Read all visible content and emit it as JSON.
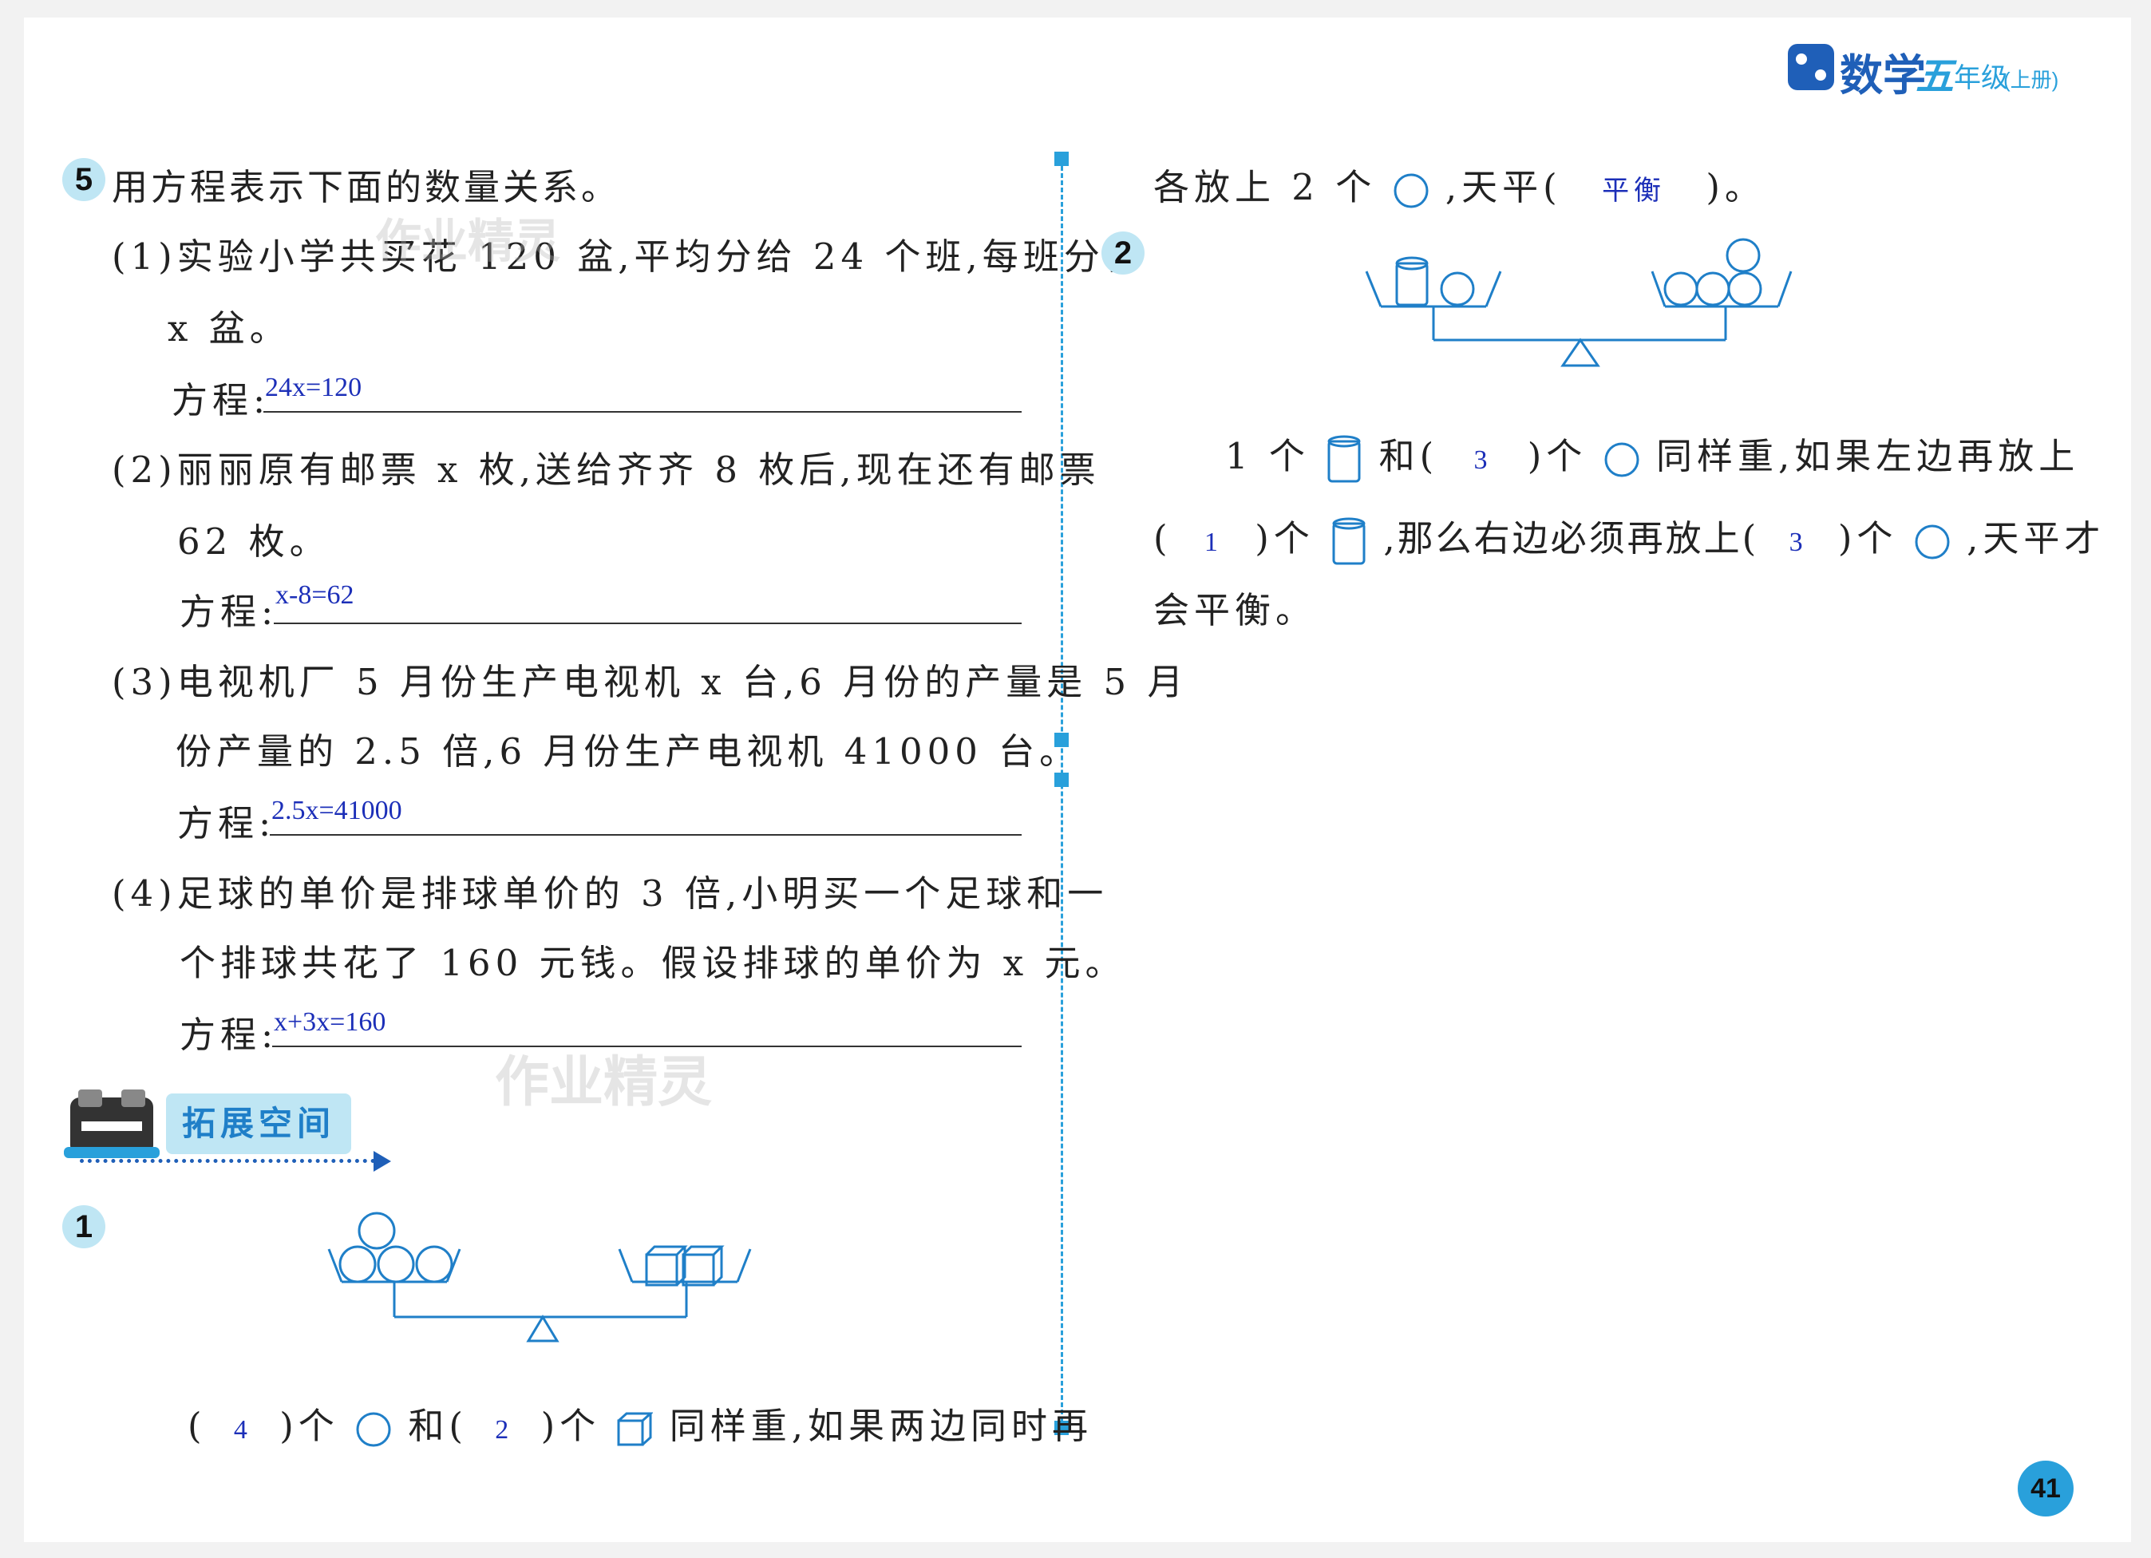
{
  "header": {
    "brand": "数学",
    "grade": "五",
    "grade_suffix": "年级",
    "volume": "(上册)"
  },
  "q5": {
    "number": "5",
    "title": "用方程表示下面的数量关系。",
    "items": [
      {
        "line1": "(1)实验小学共买花 120 盆,平均分给 24 个班,每班分得",
        "line2": "x 盆。",
        "label": "方程:",
        "answer": "24x=120"
      },
      {
        "line1": "(2)丽丽原有邮票 x 枚,送给齐齐 8 枚后,现在还有邮票",
        "line2": "62 枚。",
        "label": "方程:",
        "answer": "x-8=62"
      },
      {
        "line1": "(3)电视机厂 5 月份生产电视机 x 台,6 月份的产量是 5 月",
        "line2": "份产量的 2.5 倍,6 月份生产电视机 41000 台。",
        "label": "方程:",
        "answer": "2.5x=41000"
      },
      {
        "line1": "(4)足球的单价是排球单价的 3 倍,小明买一个足球和一",
        "line2": "个排球共花了 160 元钱。假设排球的单价为 x 元。",
        "label": "方程:",
        "answer": "x+3x=160"
      }
    ]
  },
  "section": {
    "title": "拓展空间"
  },
  "ex1": {
    "number": "1",
    "p1": "(",
    "a1": "4",
    "p2": ")个",
    "p3": "和(",
    "a2": "2",
    "p4": ")个",
    "p5": "同样重,如果两边同时再"
  },
  "ex1_cont": {
    "p1": "各放上 2 个",
    "p2": ",天平(",
    "a1": "平衡",
    "p3": ")。"
  },
  "ex2": {
    "number": "2",
    "l1a": "1 个",
    "l1b": "和(",
    "a1": "3",
    "l1c": ")个",
    "l1d": "同样重,如果左边再放上",
    "l2a": "(",
    "a2": "1",
    "l2b": ")个",
    "l2c": ",那么右边必须再放上(",
    "a3": "3",
    "l2d": ")个",
    "l2e": ",天平才",
    "l3": "会平衡。"
  },
  "watermark": "作业精灵",
  "page_number": "41",
  "colors": {
    "accent": "#29a0db",
    "answer": "#1c2fb8",
    "brand": "#1f5fb8",
    "badge": "#bfe6f4"
  }
}
